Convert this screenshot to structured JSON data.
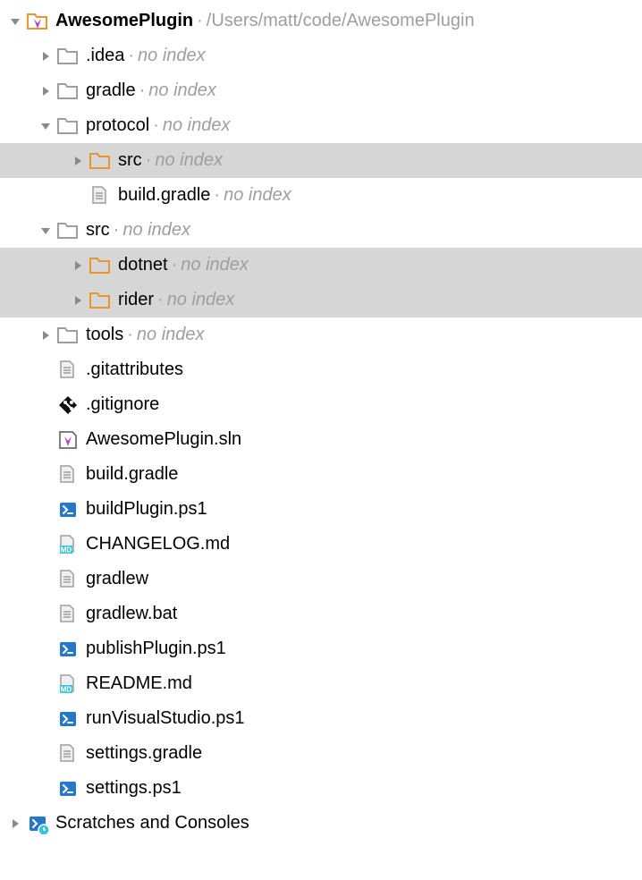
{
  "noIndex": "no index",
  "root": {
    "name": "AwesomePlugin",
    "path": "/Users/matt/code/AwesomePlugin"
  },
  "idea": {
    "name": ".idea"
  },
  "gradle": {
    "name": "gradle"
  },
  "protocol": {
    "name": "protocol"
  },
  "protocolSrc": {
    "name": "src"
  },
  "protocolBuildGradle": {
    "name": "build.gradle"
  },
  "src": {
    "name": "src"
  },
  "dotnet": {
    "name": "dotnet"
  },
  "rider": {
    "name": "rider"
  },
  "tools": {
    "name": "tools"
  },
  "gitattributes": {
    "name": ".gitattributes"
  },
  "gitignore": {
    "name": ".gitignore"
  },
  "sln": {
    "name": "AwesomePlugin.sln"
  },
  "buildGradle": {
    "name": "build.gradle"
  },
  "buildPluginPs1": {
    "name": "buildPlugin.ps1"
  },
  "changelog": {
    "name": "CHANGELOG.md"
  },
  "gradlew": {
    "name": "gradlew"
  },
  "gradlewBat": {
    "name": "gradlew.bat"
  },
  "publishPluginPs1": {
    "name": "publishPlugin.ps1"
  },
  "readme": {
    "name": "README.md"
  },
  "runVisualStudioPs1": {
    "name": "runVisualStudio.ps1"
  },
  "settingsGradle": {
    "name": "settings.gradle"
  },
  "settingsPs1": {
    "name": "settings.ps1"
  },
  "scratches": {
    "name": "Scratches and Consoles"
  }
}
